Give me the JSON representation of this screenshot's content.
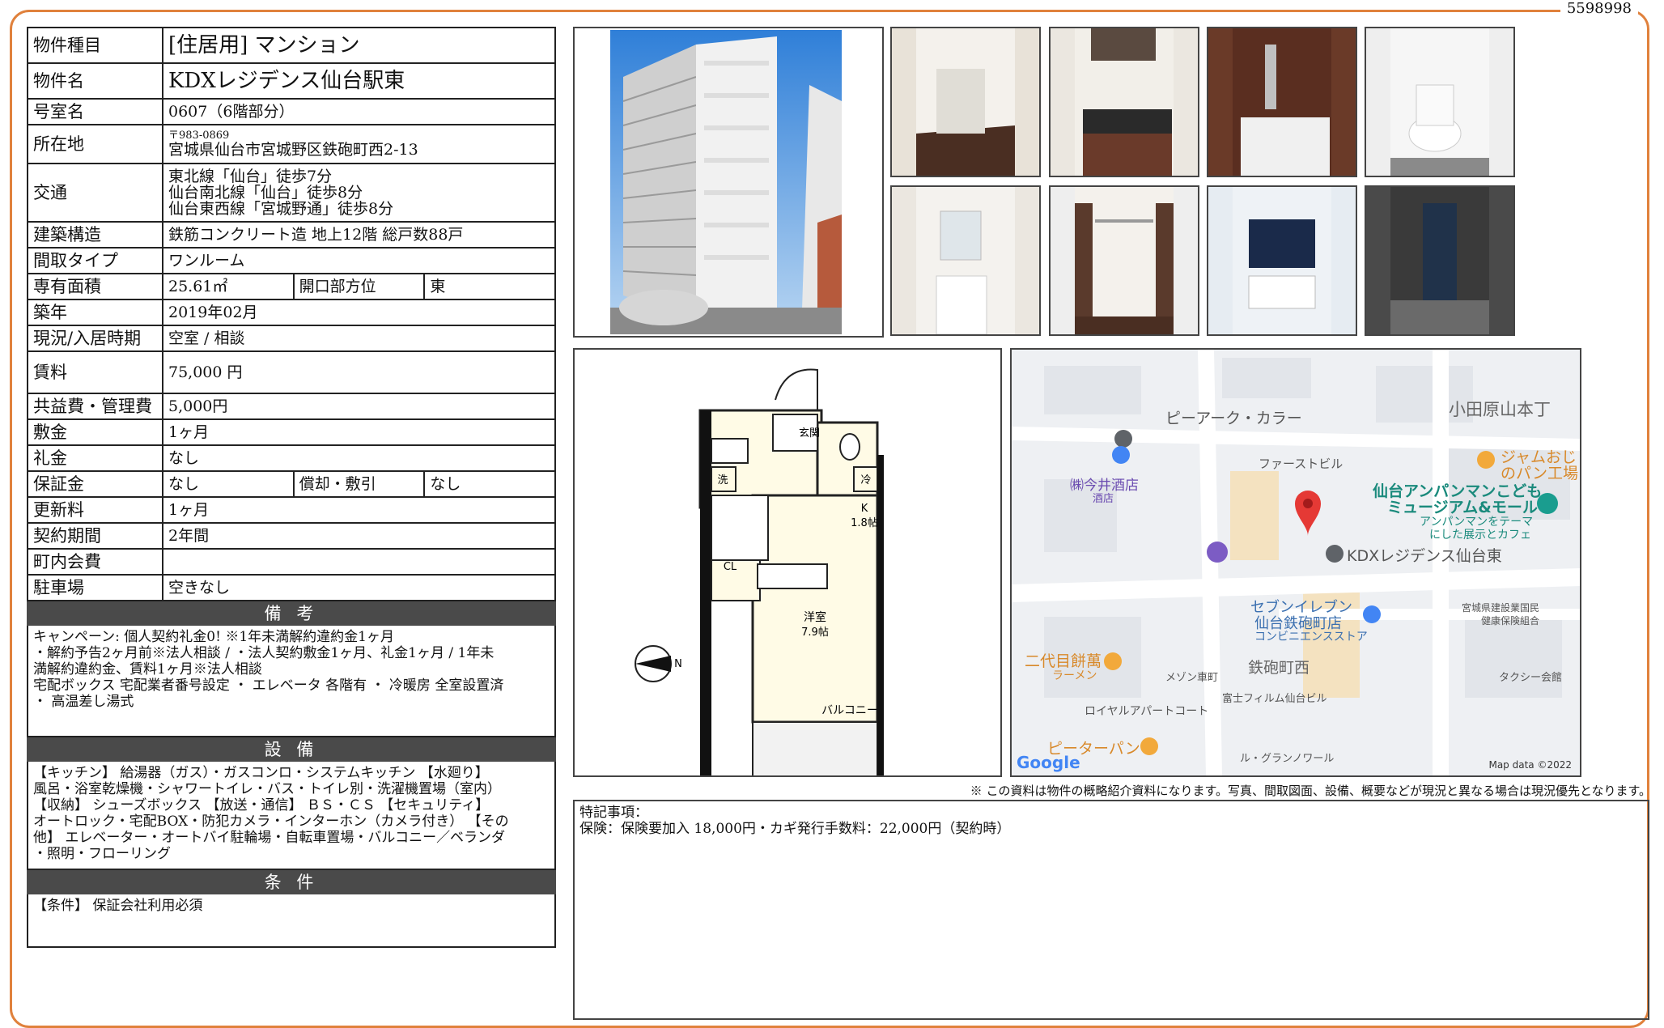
{
  "doc_id": "5598998",
  "spec": {
    "type_label": "物件種目",
    "type_value": "[住居用] マンション",
    "name_label": "物件名",
    "name_value": "KDXレジデンス仙台駅東",
    "room_label": "号室名",
    "room_value": "0607（6階部分）",
    "address_label": "所在地",
    "postal": "〒983-0869",
    "address": "宮城県仙台市宮城野区鉄砲町西2-13",
    "access_label": "交通",
    "access1": "東北線「仙台」徒歩7分",
    "access2": "仙台南北線「仙台」徒歩8分",
    "access3": "仙台東西線「宮城野通」徒歩8分",
    "structure_label": "建築構造",
    "structure_value": "鉄筋コンクリート造 地上12階 総戸数88戸",
    "layout_label": "間取タイプ",
    "layout_value": "ワンルーム",
    "area_label": "専有面積",
    "area_value": "25.61㎡",
    "direction_label": "開口部方位",
    "direction_value": "東",
    "built_label": "築年",
    "built_value": "2019年02月",
    "status_label": "現況/入居時期",
    "status_value": "空室 / 相談",
    "rent_label": "賃料",
    "rent_value": "75,000 円",
    "fee_label": "共益費・管理費",
    "fee_value": "5,000円",
    "deposit_label": "敷金",
    "deposit_value": "1ヶ月",
    "key_label": "礼金",
    "key_value": "なし",
    "guarantee_label": "保証金",
    "guarantee_value": "なし",
    "amort_label": "償却・敷引",
    "amort_value": "なし",
    "renewal_label": "更新料",
    "renewal_value": "1ヶ月",
    "contract_label": "契約期間",
    "contract_value": "2年間",
    "town_label": "町内会費",
    "town_value": "",
    "parking_label": "駐車場",
    "parking_value": "空きなし"
  },
  "remarks": {
    "title": "備 考",
    "line1": "キャンペーン: 個人契約礼金0! ※1年未満解約違約金1ヶ月",
    "line2": "・解約予告2ヶ月前※法人相談 / ・法人契約敷金1ヶ月、礼金1ヶ月 / 1年未",
    "line3": "満解約違約金、賃料1ヶ月※法人相談",
    "line4": "宅配ボックス 宅配業者番号設定 ・ エレベータ 各階有 ・ 冷暖房 全室設置済",
    "line5": "・ 高温差し湯式"
  },
  "equipment": {
    "title": "設 備",
    "line1": "【キッチン】 給湯器（ガス）・ガスコンロ・システムキッチン 【水廻り】",
    "line2": "風呂・浴室乾燥機・シャワートイレ・バス・トイレ別・洗濯機置場（室内）",
    "line3": "【収納】 シューズボックス 【放送・通信】 ＢＳ・ＣＳ 【セキュリティ】",
    "line4": "オートロック・宅配BOX・防犯カメラ・インターホン（カメラ付き） 【その",
    "line5": "他】 エレベーター・オートバイ駐輪場・自転車置場・バルコニー／ベランダ",
    "line6": "・照明・フローリング"
  },
  "conditions": {
    "title": "条 件",
    "line1": "【条件】 保証会社利用必須"
  },
  "floorplan": {
    "entrance": "玄関",
    "wash": "洗",
    "fridge": "冷",
    "kitchen": "K",
    "kitchen_size": "1.8帖",
    "closet": "CL",
    "room": "洋室",
    "room_size": "7.9帖",
    "balcony": "バルコニー",
    "north": "N"
  },
  "map": {
    "l1": "ピーアーク・カラー",
    "l2": "小田原山本丁",
    "l3": "ファーストビル",
    "l4": "ジャムおじ",
    "l5": "のパン工場",
    "l6": "㈱今井酒店",
    "l7": "酒店",
    "l8": "仙台アンパンマンこども",
    "l9": "ミュージアム&モール",
    "l10": "アンパンマンをテーマ",
    "l11": "にした展示とカフェ",
    "l12": "KDXレジデンス仙台東",
    "l13": "セブンイレブン",
    "l14": "仙台鉄砲町店",
    "l15": "コンビニエンスストア",
    "l16": "宮城県建設業国民",
    "l17": "健康保険組合",
    "l18": "二代目餅萬",
    "l19": "ラーメン",
    "l20": "メゾン車町",
    "l21": "鉄砲町西",
    "l22": "タクシー会館",
    "l23": "富士フィルム仙台ビル",
    "l24": "ロイヤルアパートコート",
    "l25": "ピーターパン",
    "l26": "ル・グランノワール",
    "google": "Google",
    "mapdata": "Map data ©2022"
  },
  "note": "※ この資料は物件の概略紹介資料になります。写真、間取図面、設備、概要などが現況と異なる場合は現況優先となります。",
  "special": {
    "title": "特記事項：",
    "line1": "保険：保険要加入 18,000円・カギ発行手数料：22,000円（契約時）"
  }
}
